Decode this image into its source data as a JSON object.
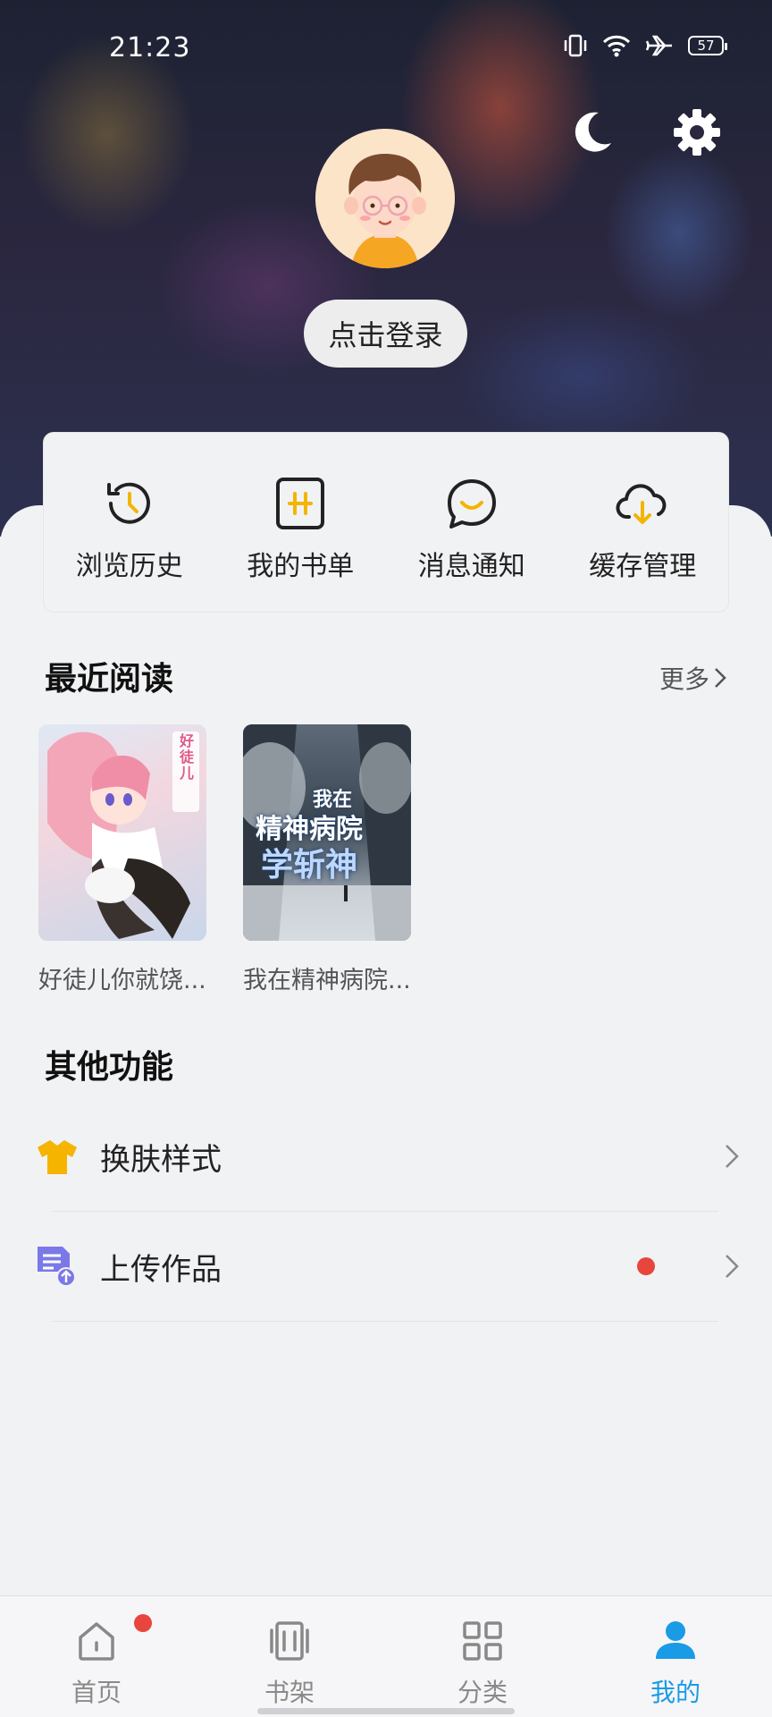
{
  "status_bar": {
    "time": "21:23",
    "battery": "57"
  },
  "header": {
    "login_label": "点击登录"
  },
  "quick_actions": [
    {
      "label": "浏览历史",
      "icon": "history-icon"
    },
    {
      "label": "我的书单",
      "icon": "booklist-icon"
    },
    {
      "label": "消息通知",
      "icon": "message-icon"
    },
    {
      "label": "缓存管理",
      "icon": "cloud-download-icon"
    }
  ],
  "recent": {
    "title": "最近阅读",
    "more_label": "更多",
    "books": [
      {
        "title": "好徒儿你就饶...",
        "cover_text": "好徒儿"
      },
      {
        "title": "我在精神病院...",
        "cover_text_1": "我在",
        "cover_text_2": "精神病院",
        "cover_text_3": "学斩神"
      }
    ]
  },
  "other": {
    "title": "其他功能",
    "items": [
      {
        "label": "换肤样式",
        "icon": "tshirt-icon"
      },
      {
        "label": "上传作品",
        "icon": "upload-document-icon"
      }
    ]
  },
  "tabs": [
    {
      "label": "首页",
      "icon": "home-icon"
    },
    {
      "label": "书架",
      "icon": "bookshelf-icon"
    },
    {
      "label": "分类",
      "icon": "category-icon"
    },
    {
      "label": "我的",
      "icon": "profile-icon"
    }
  ],
  "colors": {
    "accent": "#1a9be6",
    "badge_red": "#e8453c",
    "icon_yellow": "#f4b400",
    "upload_purple": "#7b78e8"
  }
}
